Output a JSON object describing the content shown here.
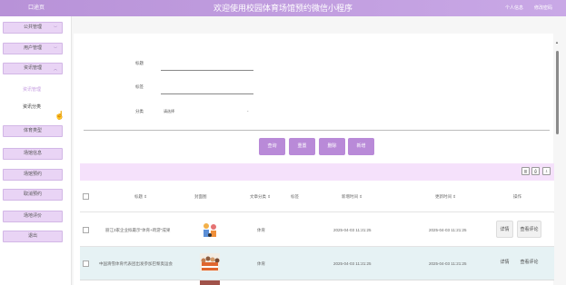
{
  "header": {
    "home": "口途页",
    "title": "欢迎使用校园体育场馆预约微信小程序",
    "personal_center": "个人信息",
    "change_password": "修改密码"
  },
  "sidebar": {
    "items": [
      {
        "label": "公共管理"
      },
      {
        "label": "用户管理"
      },
      {
        "label": "资讯管理"
      },
      {
        "label": "体育类型"
      },
      {
        "label": "场馆信息"
      },
      {
        "label": "场馆预约"
      },
      {
        "label": "取消预约"
      },
      {
        "label": "场地评价"
      },
      {
        "label": "退出"
      }
    ],
    "sub": {
      "active": "资讯管理",
      "category": "资讯分类"
    }
  },
  "search": {
    "title_label": "标题",
    "tag_label": "标签",
    "category_label": "分类",
    "category_value": "请选择"
  },
  "buttons": {
    "query": "查询",
    "reset": "重置",
    "delete": "删除",
    "add": "新增"
  },
  "toolbar_icons": [
    "filter-icon",
    "print-icon",
    "export-icon"
  ],
  "table": {
    "headers": [
      "标题 ⇕",
      "封面图",
      "文章分类 ⇕",
      "标签",
      "新增时间 ⇕",
      "更新时间 ⇕",
      "操作"
    ],
    "rows": [
      {
        "title": "丽江3家企业拟最示\"体育+跨游\"成果",
        "category": "体育",
        "created": "2025-04-03 11:21:25",
        "updated": "2025-04-03 11:21:25",
        "detail": "详情",
        "comments": "查看评论"
      },
      {
        "title": "中国滑雪体育代表团出发参加巴黎奥运会",
        "category": "体育",
        "created": "2025-04-03 11:21:25",
        "updated": "2025-04-03 11:21:25",
        "detail": "详情",
        "comments": "查看评论"
      }
    ]
  },
  "colors": {
    "accent": "#b98ad8",
    "header": "#c4a0e3",
    "sidebar_item": "#e9d4f5",
    "table_head": "#f5e1fb",
    "row_highlight": "#e6f2f4"
  }
}
